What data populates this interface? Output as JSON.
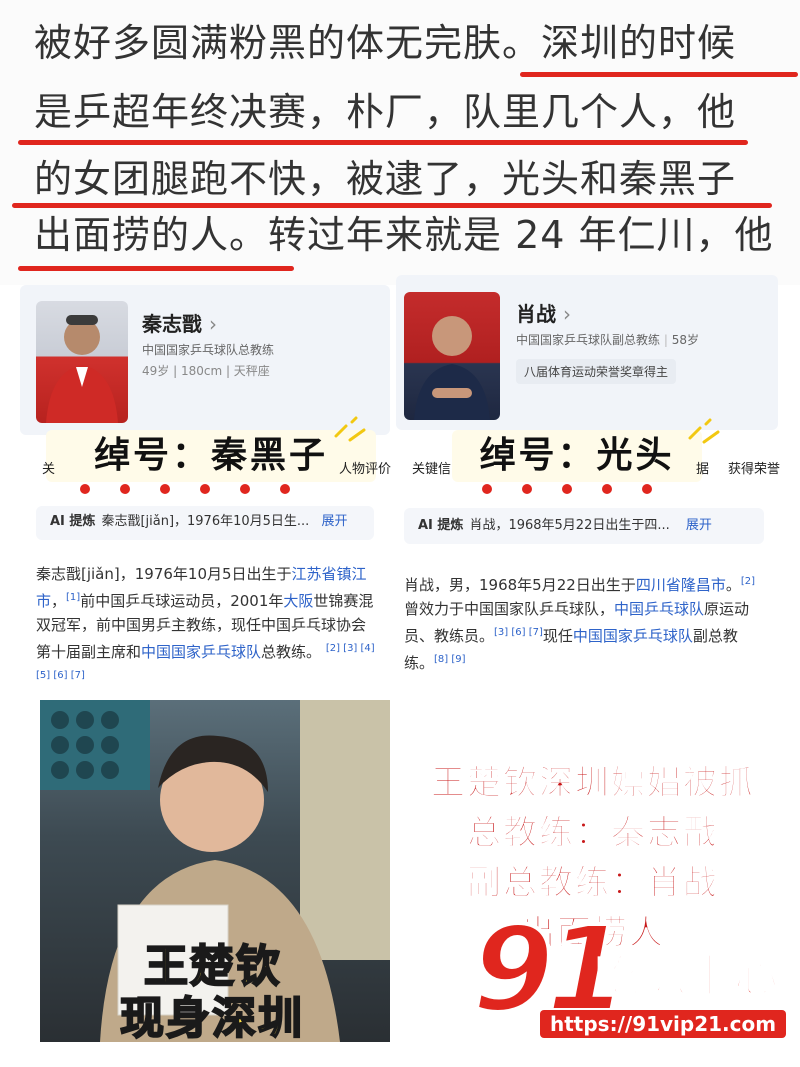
{
  "top_text": {
    "lines": [
      "被好多圆满粉黑的体无完肤。深圳的时候",
      "是乒超年终决赛，朴厂，队里几个人，他",
      "的女团腿跑不快，被逮了，光头和秦黑子",
      "出面捞的人。转过年来就是 24 年仁川，他"
    ]
  },
  "card_left": {
    "name": "秦志戬",
    "arrow": "›",
    "title": "中国国家乒乓球队总教练",
    "meta": "49岁 | 180cm | 天秤座",
    "nickname": "绰号：秦黑子",
    "tab_partial_left": "关",
    "tab_partial_right": "人物评价",
    "ai_label": "AI 提炼",
    "ai_text": "秦志戬[jiǎn]，1976年10月5日生...",
    "expand": "展开",
    "bio_parts": {
      "p1": "秦志戬[jiǎn]，1976年10月5日出生于",
      "link1": "江苏省镇江市",
      "p2": "，",
      "ref1": "[1]",
      "p3": "前中国乒乓球运动员，2001年",
      "link2": "大阪",
      "p4": "世锦赛混双冠军，前中国男乒主教练，现任中国乒乓球协会第十届副主席和",
      "link3": "中国国家乒乓球队",
      "p5": "总教练。",
      "ref2": "[2] [3] [4] [5] [6] [7]"
    }
  },
  "card_right": {
    "name": "肖战",
    "arrow": "›",
    "title": "中国国家乒乓球队副总教练",
    "age": "58岁",
    "honor": "八届体育运动荣誉奖章得主",
    "nickname": "绰号：光头",
    "tab_left": "关键信",
    "tab_mid": "据",
    "tab_right": "获得荣誉",
    "ai_label": "AI 提炼",
    "ai_text": "肖战，1968年5月22日出生于四...",
    "expand": "展开",
    "bio_parts": {
      "p1": "肖战，男，1968年5月22日出生于",
      "link1": "四川省隆昌市",
      "p2": "。",
      "ref1": "[2]",
      "p3": "曾效力于中国国家队乒乓球队，",
      "link2": "中国乒乓球队",
      "p4": "原运动员、教练员。",
      "ref2": "[3] [6] [7]",
      "p5": "现任",
      "link3": "中国国家乒乓球队",
      "p6": "副总教练。",
      "ref3": "[8] [9]"
    }
  },
  "bottom_photo": {
    "caption_line1": "王楚钦",
    "caption_line2": "现身深圳"
  },
  "red_caption": {
    "line1": "王楚钦深圳嫖娼被抓",
    "line2": "总教练：秦志戬",
    "line3": "副总教练：肖战",
    "line4": "出面捞人"
  },
  "watermark": {
    "number": "91",
    "text": "吃瓜中心",
    "url": "https://91vip21.com"
  },
  "colors": {
    "underline_red": "#e0261e",
    "link_blue": "#2e63c9",
    "caption_red": "#c8191a",
    "caption_yellow": "#ffe14a"
  }
}
